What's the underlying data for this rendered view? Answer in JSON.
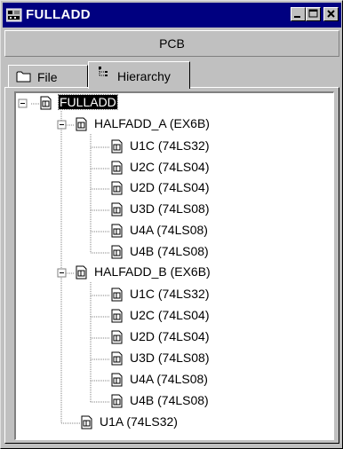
{
  "window": {
    "title": "FULLADD",
    "icon": "schematic-app-icon"
  },
  "header": {
    "label": "PCB"
  },
  "tabs": [
    {
      "label": "File",
      "icon": "folder-icon",
      "active": false
    },
    {
      "label": "Hierarchy",
      "icon": "hierarchy-icon",
      "active": true
    }
  ],
  "tree": {
    "root": {
      "label": "FULLADD",
      "selected": true,
      "expanded": true
    },
    "halfadd_a": {
      "label": "HALFADD_A (EX6B)",
      "expanded": true,
      "children": [
        "U1C (74LS32)",
        "U2C (74LS04)",
        "U2D (74LS04)",
        "U3D (74LS08)",
        "U4A (74LS08)",
        "U4B (74LS08)"
      ]
    },
    "halfadd_b": {
      "label": "HALFADD_B (EX6B)",
      "expanded": true,
      "children": [
        "U1C (74LS32)",
        "U2C (74LS04)",
        "U2D (74LS04)",
        "U3D (74LS08)",
        "U4A (74LS08)",
        "U4B (74LS08)"
      ]
    },
    "u1a": {
      "label": "U1A (74LS32)"
    }
  }
}
